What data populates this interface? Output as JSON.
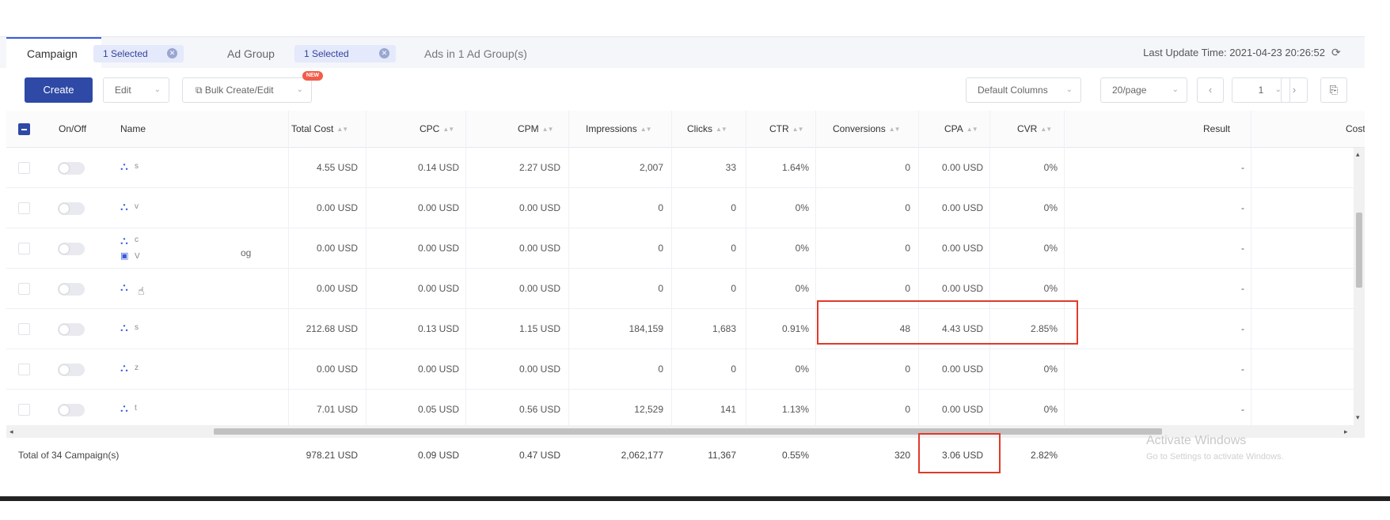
{
  "tabs": {
    "campaign": "Campaign",
    "campaign_selected": "1 Selected",
    "ad_group": "Ad Group",
    "ad_group_selected": "1 Selected",
    "ads": "Ads in 1 Ad Group(s)"
  },
  "last_update": "Last Update Time: 2021-04-23 20:26:52",
  "toolbar": {
    "create": "Create",
    "edit": "Edit",
    "bulk": "Bulk Create/Edit",
    "new_badge": "NEW",
    "columns": "Default Columns",
    "per_page": "20/page",
    "page": "1"
  },
  "table": {
    "headers": {
      "onoff": "On/Off",
      "name": "Name",
      "total_cost": "Total Cost",
      "cpc": "CPC",
      "cpm": "CPM",
      "impressions": "Impressions",
      "clicks": "Clicks",
      "ctr": "CTR",
      "conversions": "Conversions",
      "cpa": "CPA",
      "cvr": "CVR",
      "result": "Result",
      "cost": "Cost"
    },
    "rows": [
      {
        "name": "s",
        "sub": "",
        "cost": "4.55 USD",
        "cpc": "0.14 USD",
        "cpm": "2.27 USD",
        "imp": "2,007",
        "clicks": "33",
        "ctr": "1.64%",
        "conv": "0",
        "cpa": "0.00 USD",
        "cvr": "0%",
        "result": "-"
      },
      {
        "name": "v",
        "sub": "",
        "cost": "0.00 USD",
        "cpc": "0.00 USD",
        "cpm": "0.00 USD",
        "imp": "0",
        "clicks": "0",
        "ctr": "0%",
        "conv": "0",
        "cpa": "0.00 USD",
        "cvr": "0%",
        "result": "-"
      },
      {
        "name": "c",
        "sub": "V",
        "cost": "0.00 USD",
        "cpc": "0.00 USD",
        "cpm": "0.00 USD",
        "imp": "0",
        "clicks": "0",
        "ctr": "0%",
        "conv": "0",
        "cpa": "0.00 USD",
        "cvr": "0%",
        "result": "-"
      },
      {
        "name": "",
        "sub": "",
        "cost": "0.00 USD",
        "cpc": "0.00 USD",
        "cpm": "0.00 USD",
        "imp": "0",
        "clicks": "0",
        "ctr": "0%",
        "conv": "0",
        "cpa": "0.00 USD",
        "cvr": "0%",
        "result": "-"
      },
      {
        "name": "s",
        "sub": "",
        "cost": "212.68 USD",
        "cpc": "0.13 USD",
        "cpm": "1.15 USD",
        "imp": "184,159",
        "clicks": "1,683",
        "ctr": "0.91%",
        "conv": "48",
        "cpa": "4.43 USD",
        "cvr": "2.85%",
        "result": "-"
      },
      {
        "name": "z",
        "sub": "",
        "cost": "0.00 USD",
        "cpc": "0.00 USD",
        "cpm": "0.00 USD",
        "imp": "0",
        "clicks": "0",
        "ctr": "0%",
        "conv": "0",
        "cpa": "0.00 USD",
        "cvr": "0%",
        "result": "-"
      },
      {
        "name": "t",
        "sub": "",
        "cost": "7.01 USD",
        "cpc": "0.05 USD",
        "cpm": "0.56 USD",
        "imp": "12,529",
        "clicks": "141",
        "ctr": "1.13%",
        "conv": "0",
        "cpa": "0.00 USD",
        "cvr": "0%",
        "result": "-"
      }
    ],
    "stray_text": "og",
    "totals": {
      "label": "Total of 34 Campaign(s)",
      "cost": "978.21 USD",
      "cpc": "0.09 USD",
      "cpm": "0.47 USD",
      "imp": "2,062,177",
      "clicks": "11,367",
      "ctr": "0.55%",
      "conv": "320",
      "cpa": "3.06 USD",
      "cvr": "2.82%"
    }
  },
  "watermark": {
    "title": "Activate Windows",
    "subtitle": "Go to Settings to activate Windows."
  },
  "colors": {
    "accent": "#2f49a6",
    "highlight": "#e03a2a"
  }
}
